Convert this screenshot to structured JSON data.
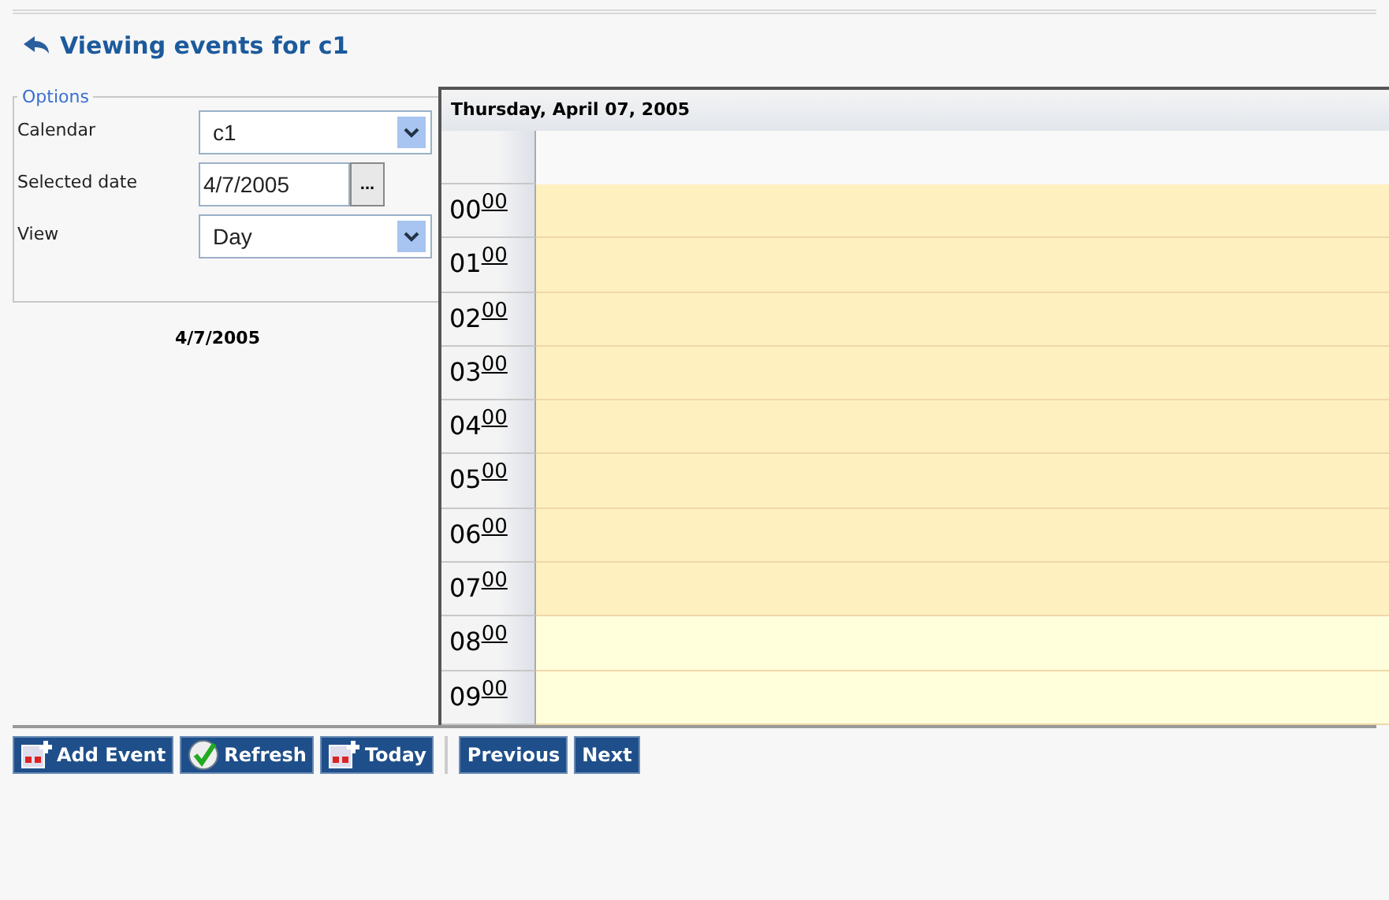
{
  "title": "Viewing events for c1",
  "options": {
    "legend": "Options",
    "fields": [
      {
        "kind": "select",
        "label": "Calendar",
        "value": "c1"
      },
      {
        "kind": "date",
        "label": "Selected date",
        "value": "4/7/2005",
        "button": "..."
      },
      {
        "kind": "select",
        "label": "View",
        "value": "Day"
      }
    ]
  },
  "mini_date": "4/7/2005",
  "day_header": "Thursday, April 07, 2005",
  "hours": [
    {
      "hour": "00",
      "minutes": "00",
      "working": false
    },
    {
      "hour": "01",
      "minutes": "00",
      "working": false
    },
    {
      "hour": "02",
      "minutes": "00",
      "working": false
    },
    {
      "hour": "03",
      "minutes": "00",
      "working": false
    },
    {
      "hour": "04",
      "minutes": "00",
      "working": false
    },
    {
      "hour": "05",
      "minutes": "00",
      "working": false
    },
    {
      "hour": "06",
      "minutes": "00",
      "working": false
    },
    {
      "hour": "07",
      "minutes": "00",
      "working": false
    },
    {
      "hour": "08",
      "minutes": "00",
      "working": true
    },
    {
      "hour": "09",
      "minutes": "00",
      "working": true
    }
  ],
  "toolbar": [
    {
      "kind": "add",
      "label": "Add Event"
    },
    {
      "kind": "check",
      "label": "Refresh"
    },
    {
      "kind": "add",
      "label": "Today"
    },
    {
      "kind": "separator"
    },
    {
      "kind": "plain",
      "label": "Previous"
    },
    {
      "kind": "plain",
      "label": "Next"
    }
  ]
}
